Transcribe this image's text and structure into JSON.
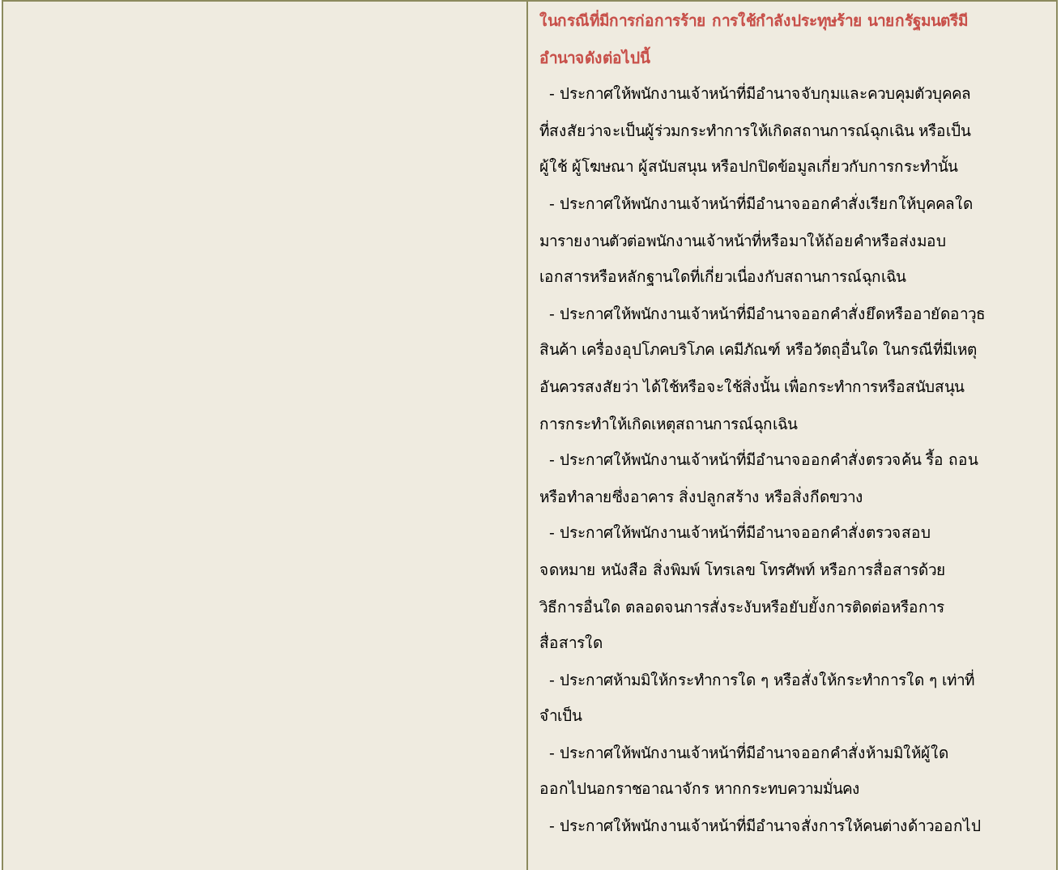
{
  "heading": {
    "lines": [
      "ในกรณีที่มีการก่อการร้าย การใช้กำลังประทุษร้าย นายกรัฐมนตรีมี",
      "อำนาจดังต่อไปนี้"
    ]
  },
  "items": [
    {
      "lines": [
        "- ประกาศให้พนักงานเจ้าหน้าที่มีอำนาจจับกุมและควบคุมตัวบุคคล",
        "ที่สงสัยว่าจะเป็นผู้ร่วมกระทำการให้เกิดสถานการณ์ฉุกเฉิน หรือเป็น",
        "ผู้ใช้ ผู้โฆษณา ผู้สนับสนุน หรือปกปิดข้อมูลเกี่ยวกับการกระทำนั้น"
      ]
    },
    {
      "lines": [
        "- ประกาศให้พนักงานเจ้าหน้าที่มีอำนาจออกคำสั่งเรียกให้บุคคลใด",
        "มารายงานตัวต่อพนักงานเจ้าหน้าที่หรือมาให้ถ้อยคำหรือส่งมอบ",
        "เอกสารหรือหลักฐานใดที่เกี่ยวเนื่องกับสถานการณ์ฉุกเฉิน"
      ]
    },
    {
      "lines": [
        "- ประกาศให้พนักงานเจ้าหน้าที่มีอำนาจออกคำสั่งยึดหรืออายัดอาวุธ",
        "สินค้า เครื่องอุปโภคบริโภค เคมีภัณฑ์ หรือวัตถุอื่นใด ในกรณีที่มีเหตุ",
        "อันควรสงสัยว่า ได้ใช้หรือจะใช้สิ่งนั้น เพื่อกระทำการหรือสนับสนุน",
        "การกระทำให้เกิดเหตุสถานการณ์ฉุกเฉิน"
      ]
    },
    {
      "lines": [
        "- ประกาศให้พนักงานเจ้าหน้าที่มีอำนาจออกคำสั่งตรวจค้น รื้อ ถอน",
        "หรือทำลายซึ่งอาคาร สิ่งปลูกสร้าง หรือสิ่งกีดขวาง"
      ]
    },
    {
      "lines": [
        "- ประกาศให้พนักงานเจ้าหน้าที่มีอำนาจออกคำสั่งตรวจสอบ",
        "จดหมาย หนังสือ สิ่งพิมพ์ โทรเลข โทรศัพท์ หรือการสื่อสารด้วย",
        "วิธีการอื่นใด ตลอดจนการสั่งระงับหรือยับยั้งการติดต่อหรือการ",
        "สื่อสารใด"
      ]
    },
    {
      "lines": [
        "- ประกาศห้ามมิให้กระทำการใด ๆ หรือสั่งให้กระทำการใด ๆ เท่าที่",
        "จำเป็น"
      ]
    },
    {
      "lines": [
        "- ประกาศให้พนักงานเจ้าหน้าที่มีอำนาจออกคำสั่งห้ามมิให้ผู้ใด",
        "ออกไปนอกราชอาณาจักร หากกระทบความมั่นคง"
      ]
    },
    {
      "lines": [
        "- ประกาศให้พนักงานเจ้าหน้าที่มีอำนาจสั่งการให้คนต่างด้าวออกไป"
      ]
    }
  ]
}
